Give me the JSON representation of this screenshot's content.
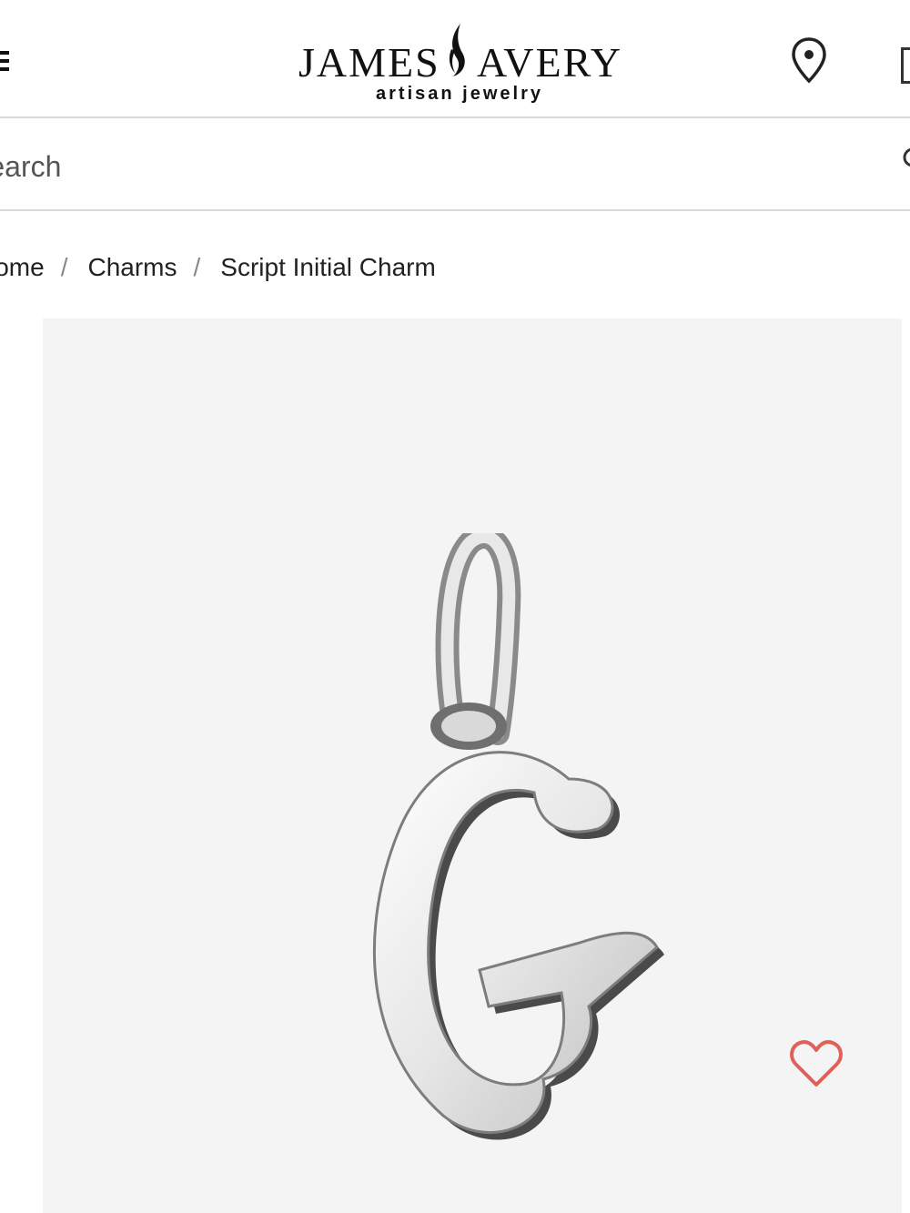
{
  "header": {
    "menu_icon": "hamburger-menu-icon",
    "logo": {
      "word_left": "JAMES",
      "word_right": "AVERY",
      "tagline": "artisan jewelry"
    },
    "location_icon": "map-pin-icon",
    "cart_icon": "cart-icon"
  },
  "search": {
    "placeholder": "Search",
    "icon": "search-icon"
  },
  "breadcrumb": {
    "items": [
      "Home",
      "Charms",
      "Script Initial Charm"
    ],
    "separator": "/"
  },
  "product": {
    "image_alt": "Script Initial Charm G",
    "wishlist_icon": "heart-icon",
    "wishlist_color": "#e0605a",
    "background_color": "#f4f4f4"
  }
}
